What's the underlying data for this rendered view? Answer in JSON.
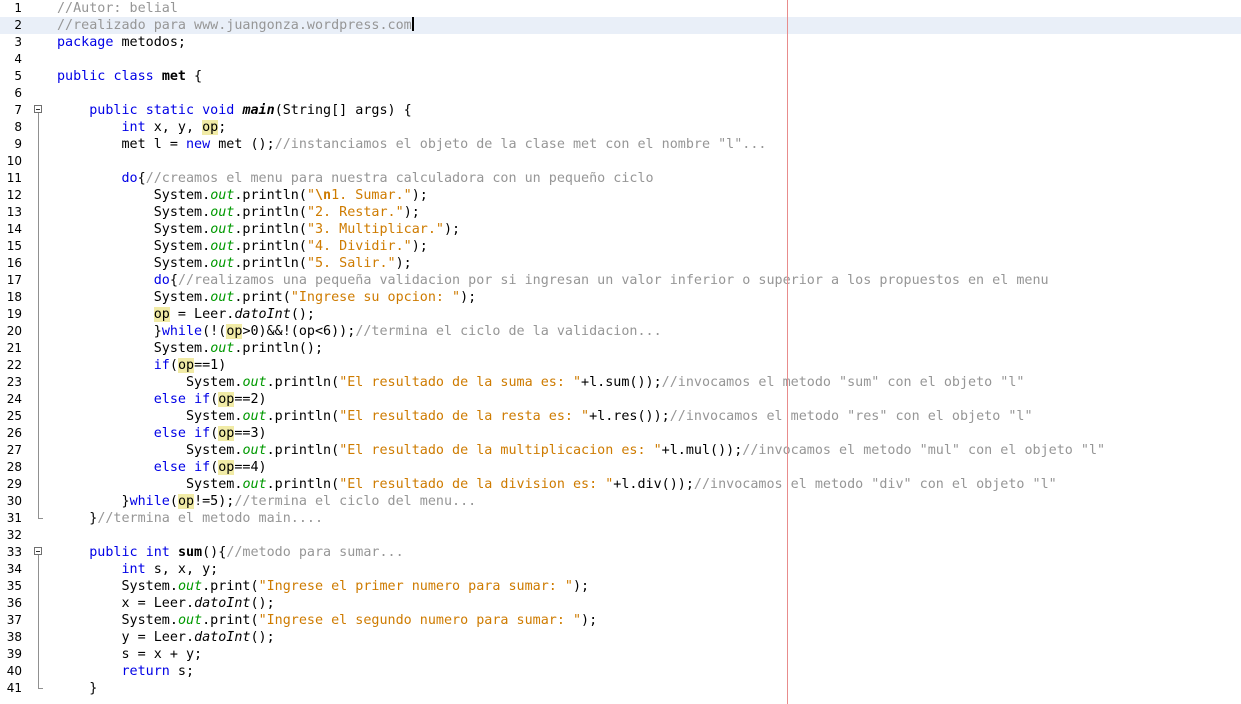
{
  "editor": {
    "current_line": 2,
    "lines": [
      {
        "n": "1",
        "t": "//Autor: belial"
      },
      {
        "n": "2",
        "t": "//realizado para www.juangonza.wordpress.com"
      },
      {
        "n": "3",
        "t": "package metodos;"
      },
      {
        "n": "4",
        "t": ""
      },
      {
        "n": "5",
        "t": "public class met {"
      },
      {
        "n": "6",
        "t": ""
      },
      {
        "n": "7",
        "t": "    public static void main(String[] args) {"
      },
      {
        "n": "8",
        "t": "        int x, y, op;"
      },
      {
        "n": "9",
        "t": "        met l = new met ();//instanciamos el objeto de la clase met con el nombre \"l\"..."
      },
      {
        "n": "10",
        "t": ""
      },
      {
        "n": "11",
        "t": "        do{//creamos el menu para nuestra calculadora con un pequeño ciclo"
      },
      {
        "n": "12",
        "t": "            System.out.println(\"\\n1. Sumar.\");"
      },
      {
        "n": "13",
        "t": "            System.out.println(\"2. Restar.\");"
      },
      {
        "n": "14",
        "t": "            System.out.println(\"3. Multiplicar.\");"
      },
      {
        "n": "15",
        "t": "            System.out.println(\"4. Dividir.\");"
      },
      {
        "n": "16",
        "t": "            System.out.println(\"5. Salir.\");"
      },
      {
        "n": "17",
        "t": "            do{//realizamos una pequeña validacion por si ingresan un valor inferior o superior a los propuestos en el menu"
      },
      {
        "n": "18",
        "t": "            System.out.print(\"Ingrese su opcion: \");"
      },
      {
        "n": "19",
        "t": "            op = Leer.datoInt();"
      },
      {
        "n": "20",
        "t": "            }while(!(op>0)&&!(op<6));//termina el ciclo de la validacion..."
      },
      {
        "n": "21",
        "t": "            System.out.println();"
      },
      {
        "n": "22",
        "t": "            if(op==1)"
      },
      {
        "n": "23",
        "t": "                System.out.println(\"El resultado de la suma es: \"+l.sum());//invocamos el metodo \"sum\" con el objeto \"l\""
      },
      {
        "n": "24",
        "t": "            else if(op==2)"
      },
      {
        "n": "25",
        "t": "                System.out.println(\"El resultado de la resta es: \"+l.res());//invocamos el metodo \"res\" con el objeto \"l\""
      },
      {
        "n": "26",
        "t": "            else if(op==3)"
      },
      {
        "n": "27",
        "t": "                System.out.println(\"El resultado de la multiplicacion es: \"+l.mul());//invocamos el metodo \"mul\" con el objeto \"l\""
      },
      {
        "n": "28",
        "t": "            else if(op==4)"
      },
      {
        "n": "29",
        "t": "                System.out.println(\"El resultado de la division es: \"+l.div());//invocamos el metodo \"div\" con el objeto \"l\""
      },
      {
        "n": "30",
        "t": "        }while(op!=5);//termina el ciclo del menu..."
      },
      {
        "n": "31",
        "t": "    }//termina el metodo main...."
      },
      {
        "n": "32",
        "t": ""
      },
      {
        "n": "33",
        "t": "    public int sum(){//metodo para sumar..."
      },
      {
        "n": "34",
        "t": "        int s, x, y;"
      },
      {
        "n": "35",
        "t": "        System.out.print(\"Ingrese el primer numero para sumar: \");"
      },
      {
        "n": "36",
        "t": "        x = Leer.datoInt();"
      },
      {
        "n": "37",
        "t": "        System.out.print(\"Ingrese el segundo numero para sumar: \");"
      },
      {
        "n": "38",
        "t": "        y = Leer.datoInt();"
      },
      {
        "n": "39",
        "t": "        s = x + y;"
      },
      {
        "n": "40",
        "t": "        return s;"
      },
      {
        "n": "41",
        "t": "    }"
      }
    ]
  },
  "colors": {
    "keyword": "#0000e6",
    "comment": "#969696",
    "string": "#ce7b00",
    "field": "#009900",
    "highlight": "#f1eba6",
    "current_line": "#e9eff8",
    "right_margin": "#e88c8c"
  },
  "icons": {
    "fold_open": "fold-collapse-icon",
    "fold_end": "fold-end-icon"
  }
}
